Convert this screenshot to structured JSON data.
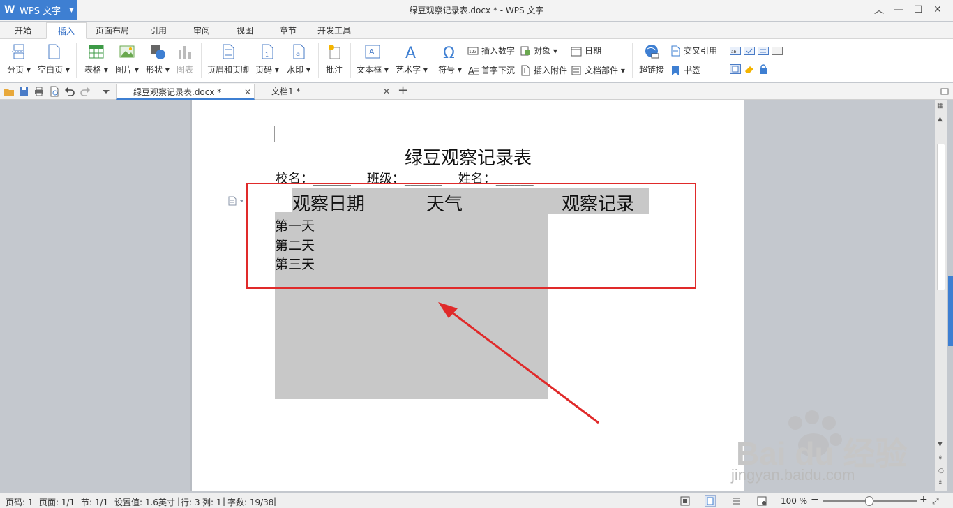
{
  "titlebar": {
    "app_name": "WPS 文字",
    "window_title": "绿豆观察记录表.docx * - WPS 文字"
  },
  "menu_tabs": [
    "开始",
    "插入",
    "页面布局",
    "引用",
    "审阅",
    "视图",
    "章节",
    "开发工具"
  ],
  "active_tab": "插入",
  "ribbon": {
    "page_break": "分页",
    "blank_page": "空白页",
    "table": "表格",
    "picture": "图片",
    "shape": "形状",
    "chart": "图表",
    "header_footer": "页眉和页脚",
    "page_number": "页码",
    "watermark": "水印",
    "comment": "批注",
    "textbox": "文本框",
    "wordart": "艺术字",
    "symbol": "符号",
    "insert_number": "插入数字",
    "object": "对象",
    "date": "日期",
    "drop_cap": "首字下沉",
    "insert_attachment": "插入附件",
    "doc_parts": "文档部件",
    "hyperlink": "超链接",
    "cross_ref": "交叉引用",
    "bookmark": "书签"
  },
  "doc_tabs": [
    {
      "label": "绿豆观察记录表.docx *",
      "active": true
    },
    {
      "label": "文档1 *",
      "active": false
    }
  ],
  "document": {
    "title": "绿豆观察记录表",
    "info_line": "校名：______    班级：______    姓名：______",
    "headers": [
      "观察日期",
      "天气",
      "观察记录"
    ],
    "rows": [
      "第一天",
      "第二天",
      "第三天"
    ]
  },
  "statusbar": {
    "page_no": "页码: 1",
    "pages": "页面: 1/1",
    "section": "节: 1/1",
    "setting": "设置值: 1.6英寸",
    "line": "行: 3",
    "column": "列: 1",
    "word_count": "字数: 19/38",
    "zoom": "100 %"
  },
  "watermark": {
    "brand": "Bai du 经验",
    "url": "jingyan.baidu.com"
  },
  "colors": {
    "accent": "#3e7fd2",
    "annotation": "#e02a2a",
    "shading": "#c8c8c8"
  }
}
